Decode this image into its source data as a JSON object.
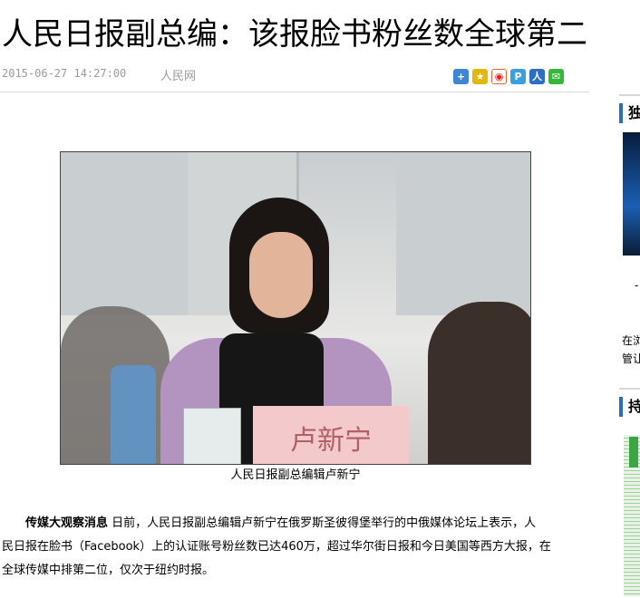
{
  "article": {
    "headline": "人民日报副总编：该报脸书粉丝数全球第二",
    "date": "2015-06-27 14:27:00",
    "source": "人民网",
    "image_caption": "人民日报副总编辑卢新宁",
    "nameplate_text": "卢新宁",
    "body_lead": "传媒大观察消息",
    "body_line1": "日前，人民日报副总编辑卢新宁在俄罗斯圣彼得堡举行的中俄媒体论坛上表示，人",
    "body_line2": "民日报在脸书（Facebook）上的认证账号粉丝数已达460万，超过华尔街日报和今日美国等西方大报，在",
    "body_line3": "全球传媒中排第二位，仅次于纽约时报。"
  },
  "share_icons": [
    "plus-share-icon",
    "qzone-star-icon",
    "weibo-icon",
    "pengyou-icon",
    "renren-icon",
    "wechat-icon"
  ],
  "sidebar": {
    "heading1": "独",
    "heading2": "持",
    "dash": "-",
    "text1_line1": "在浏",
    "text1_line2": "管让"
  },
  "colors": {
    "accent_blue": "#2a6cc0",
    "meta_gray": "#9a9a9a",
    "divider": "#d9d9d9"
  }
}
